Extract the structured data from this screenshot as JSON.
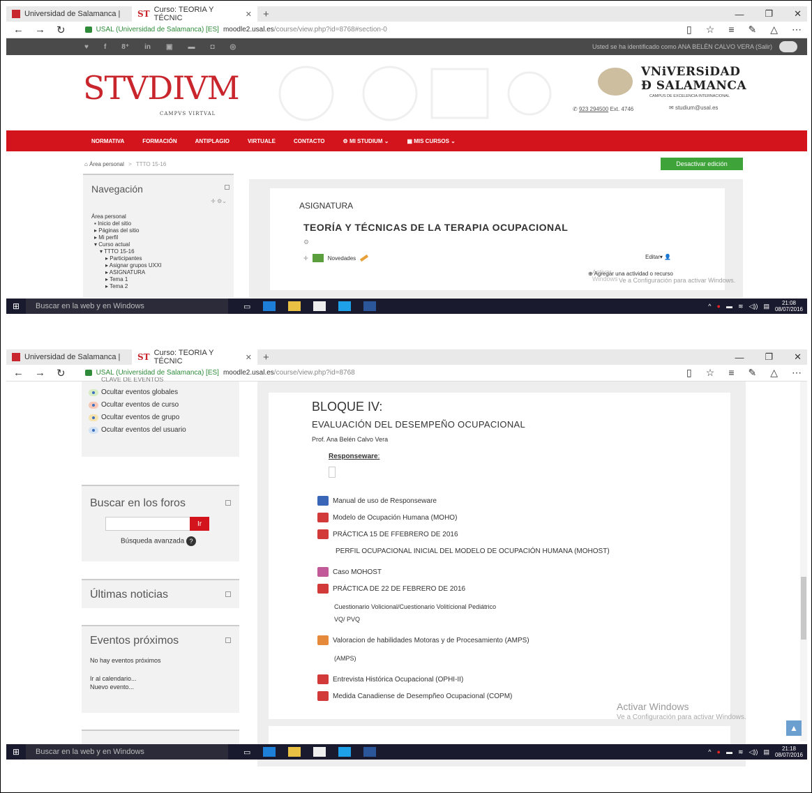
{
  "shot1": {
    "tabs": [
      {
        "label": "Universidad de Salamanca |"
      },
      {
        "label": "Curso: TEORÍA Y TÉCNIC"
      }
    ],
    "address": {
      "site": "USAL (Universidad de Salamanca) [ES]",
      "host": "moodle2.usal.es",
      "path": "/course/view.php?id=8768#section-0"
    },
    "login_text": "Usted se ha identificado como ANA BELÉN CALVO VERA (Salir)",
    "logo_text": "STVDIVM",
    "logo_sub": "CAMPVS VIRTVAL",
    "university_line1": "VNiVERSiDAD",
    "university_line2": "Ð SALAMANCA",
    "excellence": "CAMPUS DE EXCELENCIA INTERNACIONAL",
    "phone": "923 294500",
    "phone_ext": "Ext. 4746",
    "email": "studium@usal.es",
    "menu": [
      "NORMATIVA",
      "FORMACIÓN",
      "ANTIPLAGIO",
      "VIRTUALE",
      "CONTACTO",
      "MI STUDIUM",
      "MIS CURSOS"
    ],
    "breadcrumb": {
      "home": "Área personal",
      "sep": ">",
      "current": "TTTO 15-16"
    },
    "deactivate_button": "Desactivar edición",
    "navigation": {
      "title": "Navegación",
      "items": [
        "Área personal",
        "Inicio del sitio",
        "Páginas del sitio",
        "Mi perfil",
        "Curso actual",
        "TTTO 15-16",
        "Participantes",
        "Asignar grupos UXXI",
        "ASIGNATURA",
        "Tema 1",
        "Tema 2"
      ]
    },
    "section_label": "ASIGNATURA",
    "course_title": "TEORÍA Y TÉCNICAS DE LA TERAPIA OCUPACIONAL",
    "news_label": "Novedades",
    "edit_label": "Editar",
    "add_activity": "Agregar una actividad o recurso",
    "watermark1": "Activar Windows",
    "watermark2": "Ve a Configuración para activar Windows.",
    "taskbar": {
      "search": "Buscar en la web y en Windows",
      "time": "21:08",
      "date": "08/07/2016"
    }
  },
  "shot2": {
    "tabs": [
      {
        "label": "Universidad de Salamanca |"
      },
      {
        "label": "Curso: TEORÍA Y TÉCNIC"
      }
    ],
    "address": {
      "site": "USAL (Universidad de Salamanca) [ES]",
      "host": "moodle2.usal.es",
      "path": "/course/view.php?id=8768"
    },
    "events_key_title": "CLAVE DE EVENTOS",
    "events_key": [
      "Ocultar eventos globales",
      "Ocultar eventos de curso",
      "Ocultar eventos de grupo",
      "Ocultar eventos del usuario"
    ],
    "event_colors": [
      "#d8ecc4",
      "#f7c8b8",
      "#f7e3b0",
      "#d4e3f4"
    ],
    "forum_search": {
      "title": "Buscar en los foros",
      "button": "Ir",
      "advanced": "Búsqueda avanzada"
    },
    "latest_news": {
      "title": "Últimas noticias"
    },
    "upcoming": {
      "title": "Eventos próximos",
      "none": "No hay eventos próximos",
      "calendar_link": "Ir al calendario...",
      "new_event": "Nuevo evento..."
    },
    "block_title": "BLOQUE IV:",
    "block_subtitle": "EVALUACIÓN DEL DESEMPEÑO OCUPACIONAL",
    "professor": "Prof. Ana Belén Calvo Vera",
    "responseware": "Responseware",
    "resources": [
      {
        "label": "Manual de uso de Responseware",
        "icon": "word"
      },
      {
        "label": "Modelo de Ocupación Humana (MOHO)",
        "icon": "pdf"
      },
      {
        "label": "PRÁCTICA 15 DE FFEBRERO DE 2016",
        "icon": "pdf"
      },
      {
        "label": "Caso MOHOST",
        "icon": "img"
      },
      {
        "label": "PRÁCTICA DE 22 DE FEBRERO DE 2016",
        "icon": "pdf"
      },
      {
        "label": "Valoracion de habilidades Motoras y de Procesamiento (AMPS)",
        "icon": "ppt"
      },
      {
        "label": "Entrevista Histórica Ocupacional (OPHI-II)",
        "icon": "pdf"
      },
      {
        "label": "Medida Canadiense de Desempñeo Ocupacional (COPM)",
        "icon": "pdf"
      }
    ],
    "sublabels": {
      "mohost": "PERFIL OCUPACIONAL INICIAL DEL MODELO DE OCUPACIÓN HUMANA (MOHOST)",
      "vq1": "Cuestionario Volicional/Cuestionario Volitícional Pediátrico",
      "vq2": "VQ/ PVQ",
      "amps": "(AMPS)"
    },
    "watermark1": "Activar Windows",
    "watermark2": "Ve a Configuración para activar Windows.",
    "taskbar": {
      "search": "Buscar en la web y en Windows",
      "time": "21:18",
      "date": "08/07/2016"
    }
  }
}
